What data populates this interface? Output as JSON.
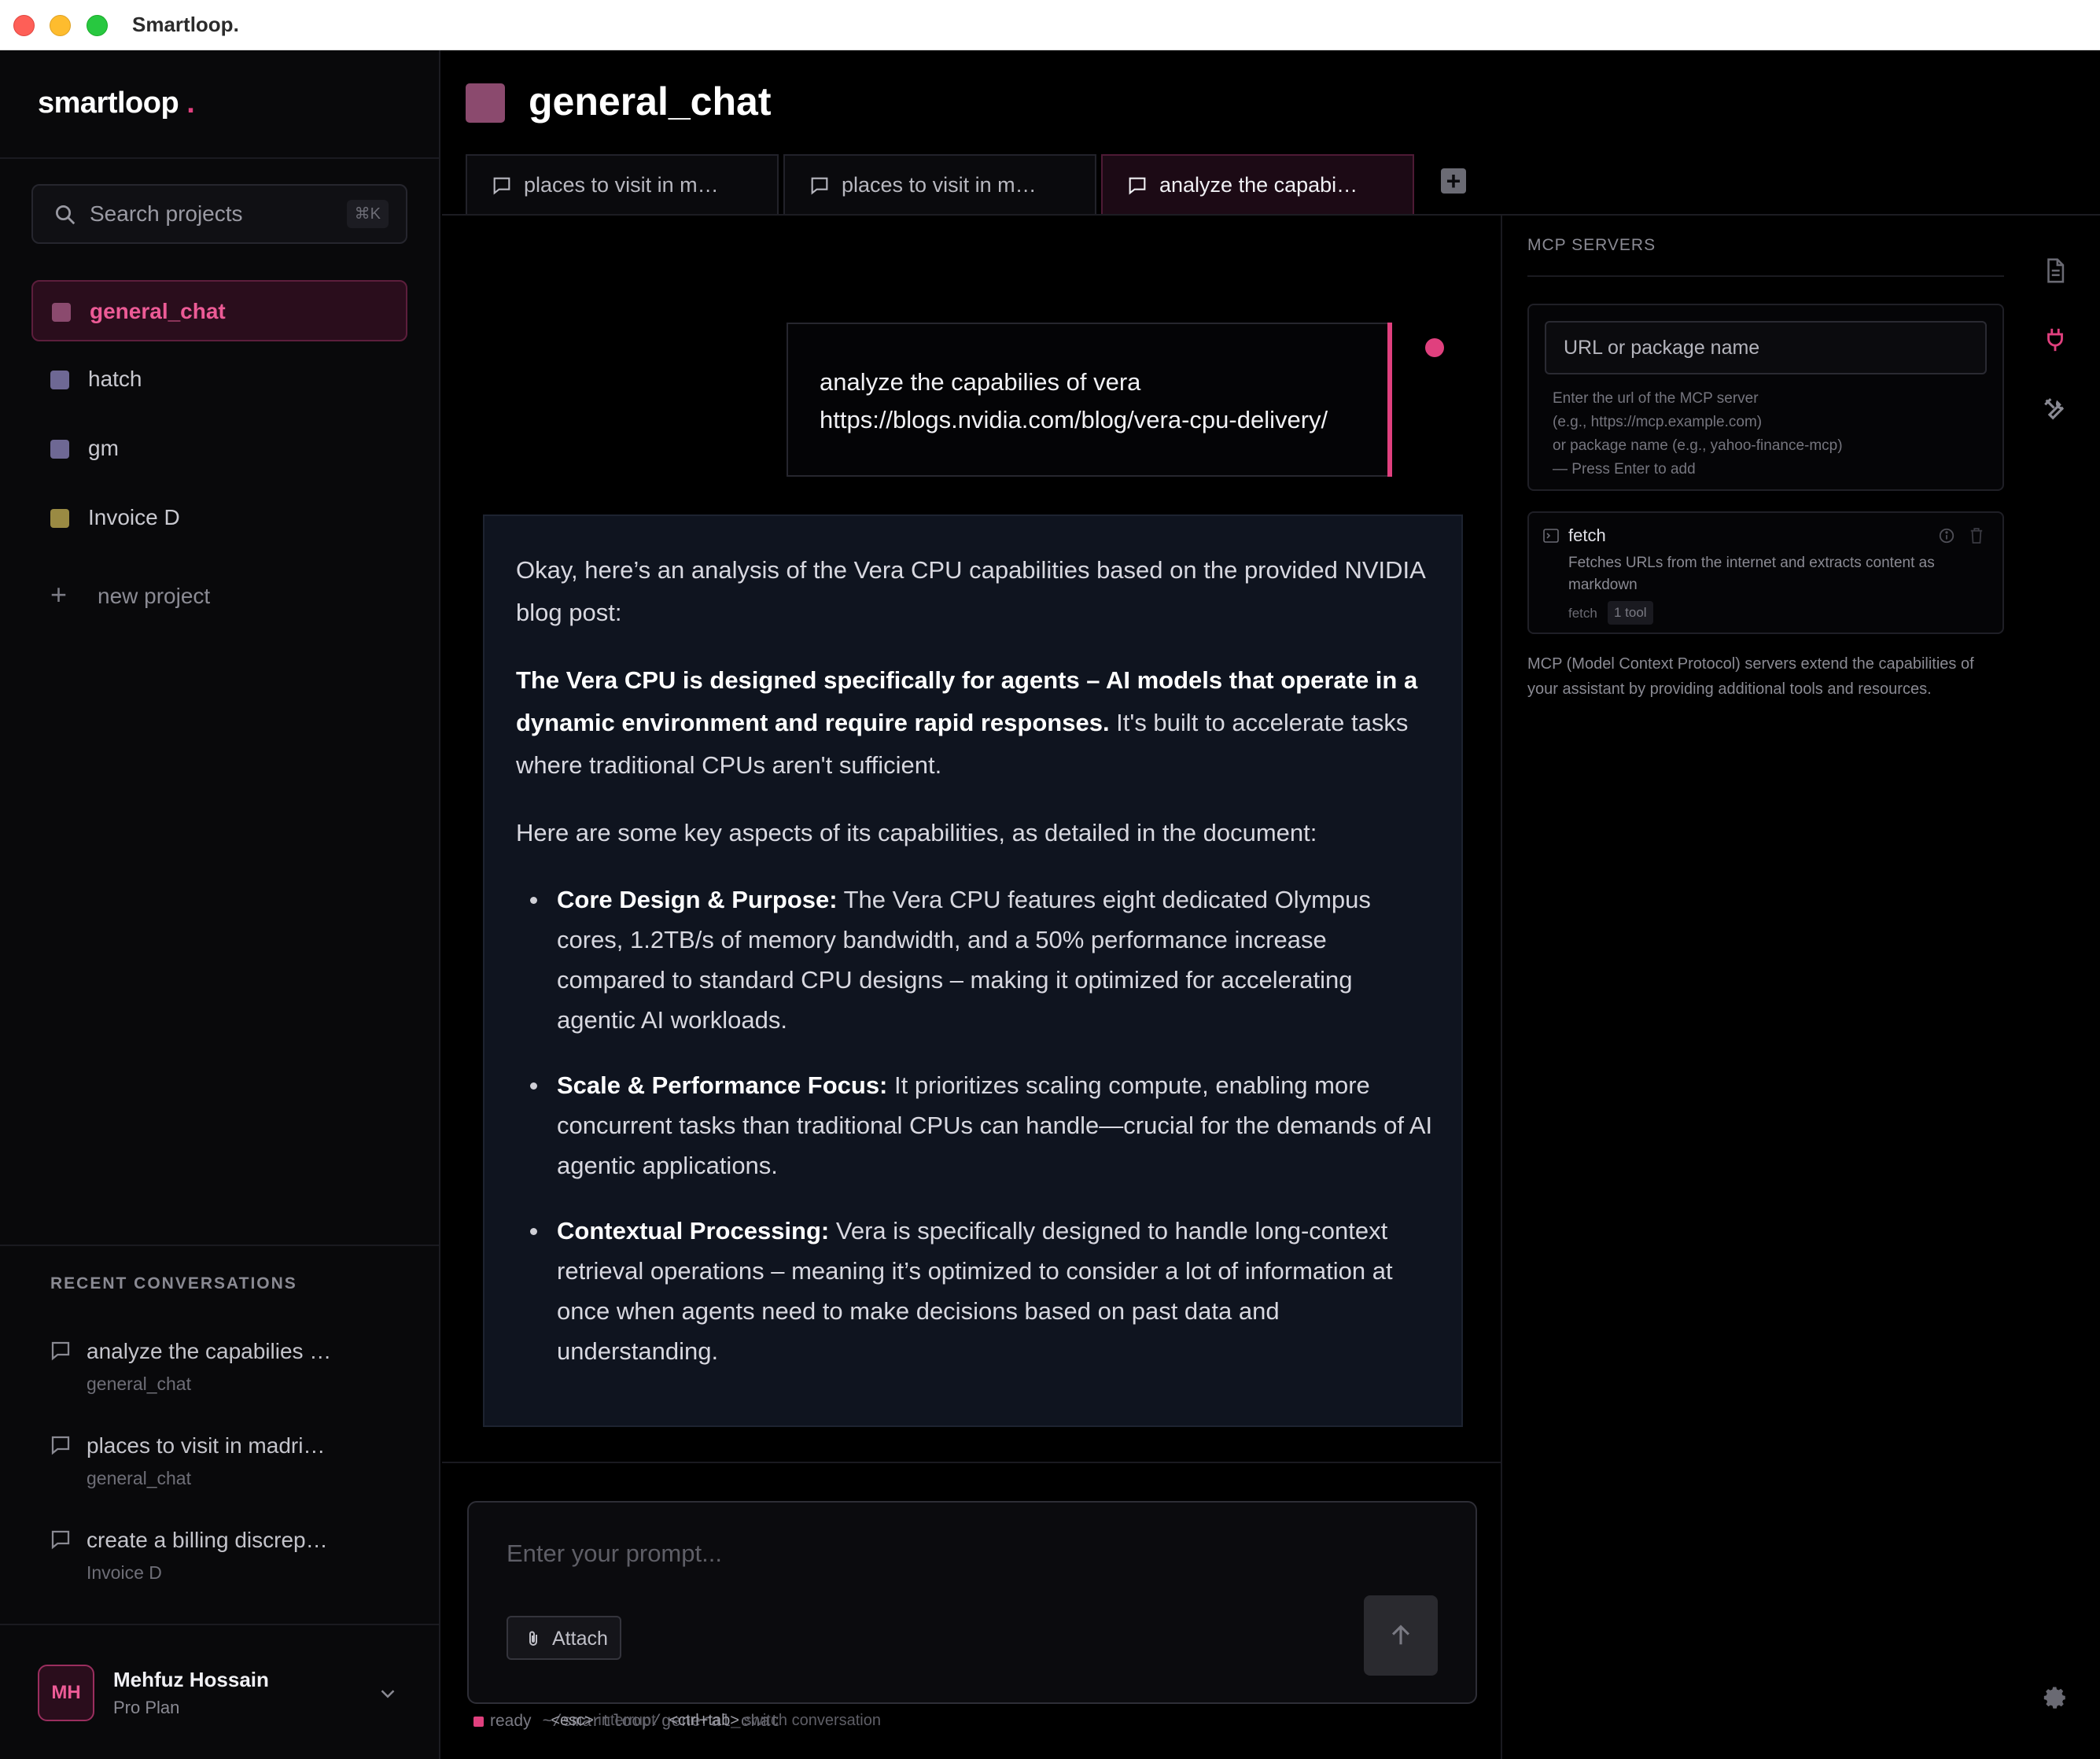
{
  "window": {
    "title": "Smartloop."
  },
  "sidebar": {
    "brand": "smartloop",
    "brand_dot": ".",
    "search": {
      "placeholder": "Search projects",
      "shortcut": "⌘K"
    },
    "projects": [
      {
        "label": "general_chat",
        "color": "#8b4a6e",
        "active": true
      },
      {
        "label": "hatch",
        "color": "#6e6894",
        "active": false
      },
      {
        "label": "gm",
        "color": "#6e6894",
        "active": false
      },
      {
        "label": "Invoice D",
        "color": "#9a8a43",
        "active": false
      }
    ],
    "new_project": "new project",
    "recent_heading": "RECENT CONVERSATIONS",
    "recent": [
      {
        "title": "analyze the capabilies …",
        "project": "general_chat"
      },
      {
        "title": "places to visit in madri…",
        "project": "general_chat"
      },
      {
        "title": "create a billing discrep…",
        "project": "Invoice D"
      }
    ],
    "user": {
      "initials": "MH",
      "name": "Mehfuz Hossain",
      "plan": "Pro Plan"
    }
  },
  "main": {
    "project_title": "general_chat",
    "tabs": [
      {
        "label": "places to visit in m…",
        "active": false
      },
      {
        "label": "places to visit in m…",
        "active": false
      },
      {
        "label": "analyze the capabi…",
        "active": true
      }
    ],
    "user_message": "analyze the capabilies of vera\nhttps://blogs.nvidia.com/blog/vera-cpu-delivery/",
    "assistant": {
      "intro": "Okay, here’s an analysis of the Vera CPU capabilities based on the provided NVIDIA blog post:",
      "summary_bold": "The Vera CPU is designed specifically for agents – AI models that operate in a dynamic environment and require rapid responses.",
      "summary_rest": " It's built to accelerate tasks where traditional CPUs aren't sufficient.",
      "lead": "Here are some key aspects of its capabilities, as detailed in the document:",
      "bullets": [
        {
          "head": "Core Design & Purpose:",
          "text": " The Vera CPU features eight dedicated Olympus cores, 1.2TB/s of memory bandwidth, and a 50% performance increase compared to standard CPU designs – making it optimized for accelerating agentic AI workloads."
        },
        {
          "head": "Scale & Performance Focus:",
          "text": " It prioritizes scaling compute, enabling more concurrent tasks than traditional CPUs can handle—crucial for the demands of AI agentic applications."
        },
        {
          "head": "Contextual Processing:",
          "text": " Vera is specifically designed to handle long-context retrieval operations – meaning it’s optimized to consider a lot of information at once when agents need to make decisions based on past data and understanding."
        }
      ]
    },
    "composer": {
      "placeholder": "Enter your prompt...",
      "attach_label": "Attach"
    },
    "status": {
      "state": "ready",
      "path": "~/smartloop/general_chat",
      "hint1_key": "<esc>",
      "hint1_text": " interrupt",
      "hint2_key": "<ctrl+tab>",
      "hint2_text": " switch conversation"
    }
  },
  "mcp": {
    "heading": "MCP SERVERS",
    "input_placeholder": "URL or package name",
    "help": "Enter the url of the MCP server\n(e.g., https://mcp.example.com)\nor package name (e.g., yahoo-finance-mcp)\n— Press Enter to add",
    "servers": [
      {
        "name": "fetch",
        "description": "Fetches URLs from the internet and extracts content as markdown",
        "tag": "fetch",
        "tool_count": "1 tool"
      }
    ],
    "note": "MCP (Model Context Protocol) servers extend the capabilities of your assistant by providing additional tools and resources."
  },
  "theme": {
    "accent": "#e0407e",
    "bg": "#000000",
    "assistant_bg": "#0f141f"
  }
}
